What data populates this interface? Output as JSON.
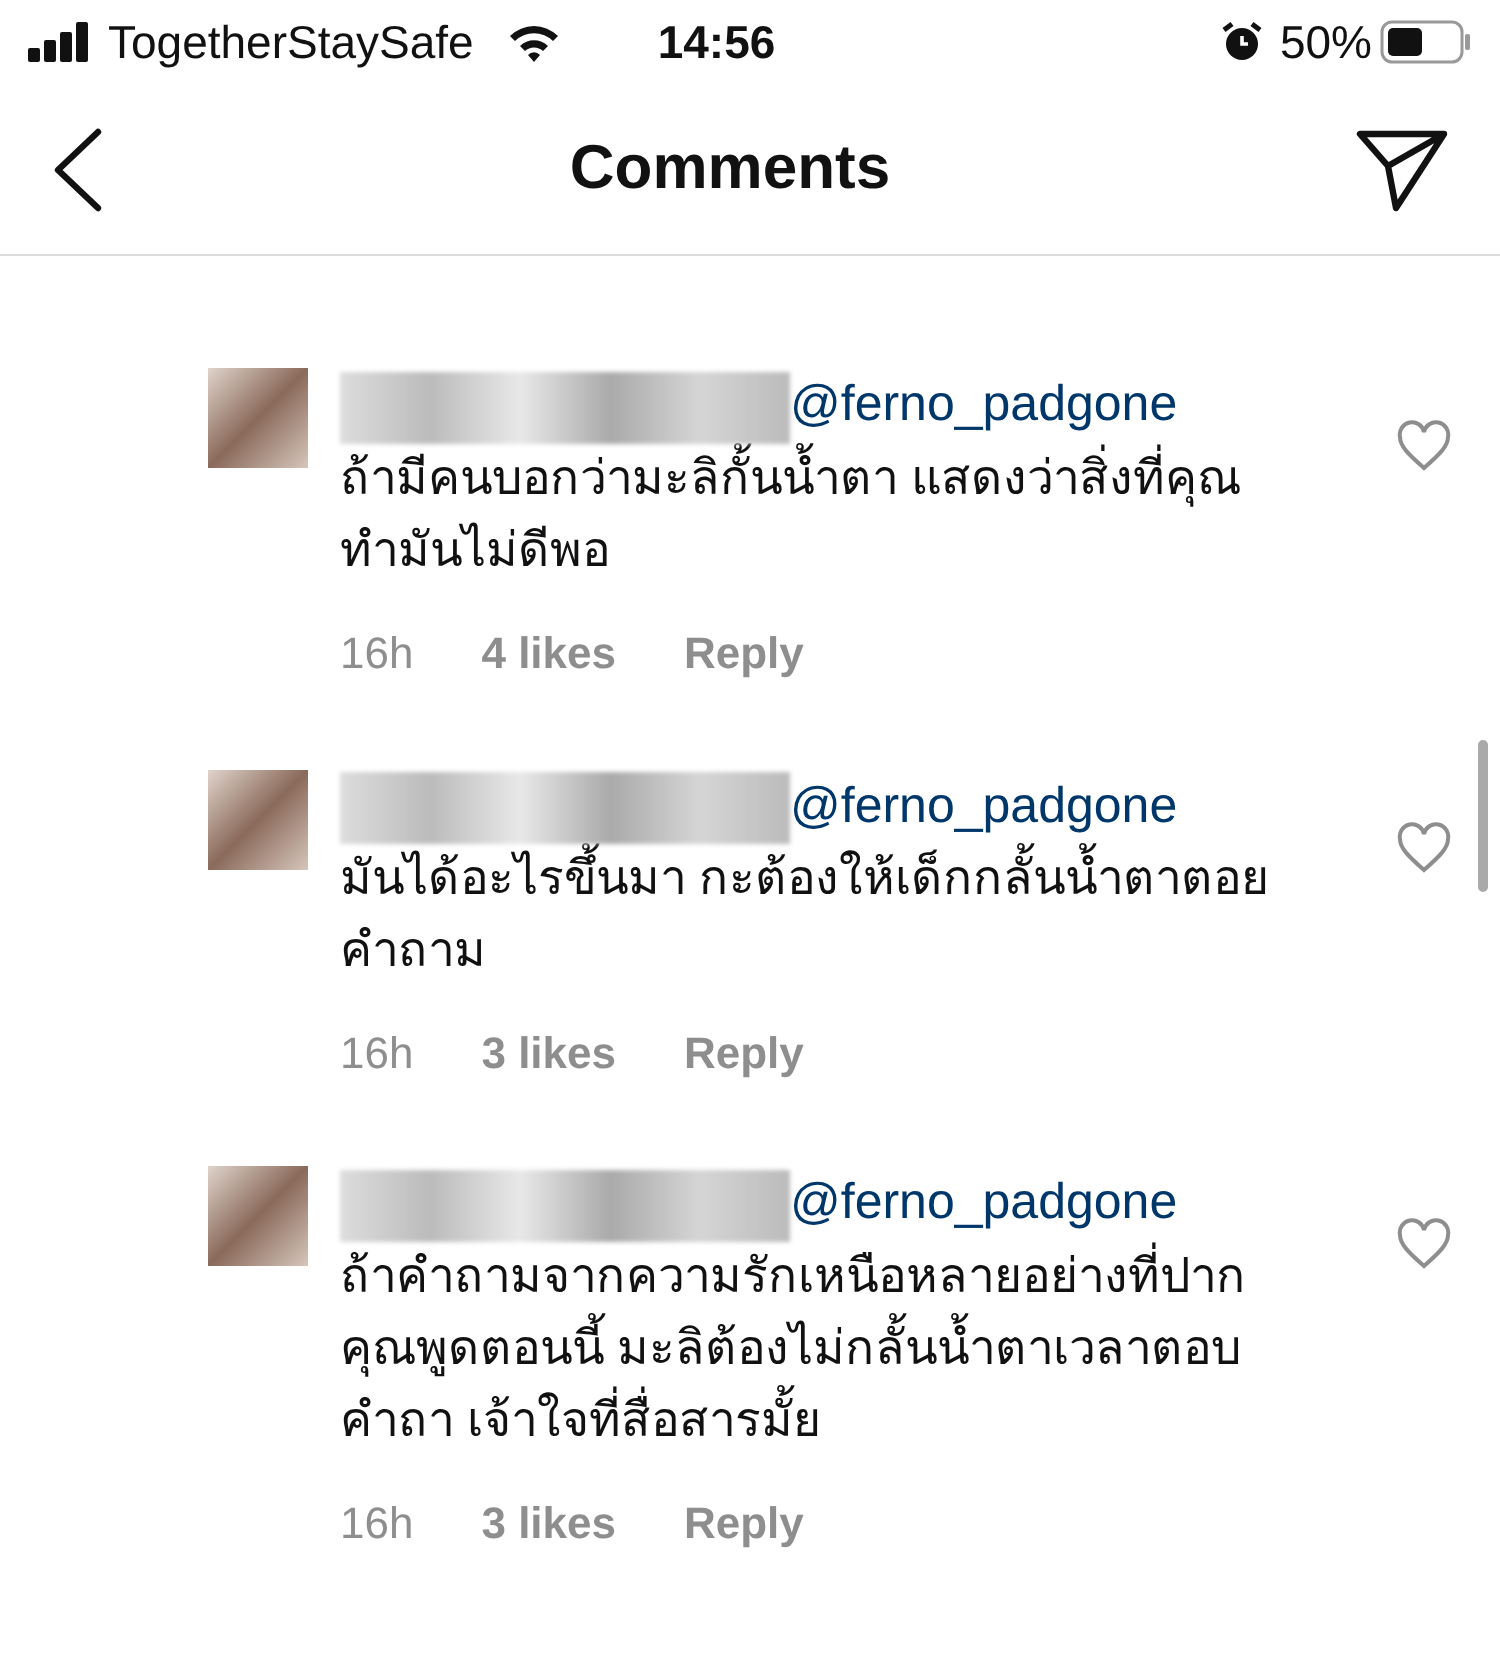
{
  "status_bar": {
    "carrier": "TogetherStaySafe",
    "time": "14:56",
    "battery": "50%"
  },
  "header": {
    "title": "Comments"
  },
  "comments": [
    {
      "mention": "@ferno_padgone",
      "text": "ถ้ามีคนบอกว่ามะลิกั้นน้ำตา แสดงว่าสิ่งที่คุณทำมันไม่ดีพอ",
      "time": "16h",
      "likes": "4 likes",
      "reply": "Reply",
      "liked": false
    },
    {
      "mention": "@ferno_padgone",
      "text": "มันได้อะไรขึ้นมา กะต้องให้เด็กกลั้นน้ำตาตอยคำถาม",
      "time": "16h",
      "likes": "3 likes",
      "reply": "Reply",
      "liked": false
    },
    {
      "mention": "@ferno_padgone",
      "text": "ถ้าคำถามจากความรักเหนือหลายอย่างที่ปากคุณพูดตอนนี้ มะลิต้องไม่กลั้นน้ำตาเวลาตอบคำถา  เจ้าใจที่สื่อสารมั้ย",
      "time": "16h",
      "likes": "3 likes",
      "reply": "Reply",
      "liked": false
    }
  ]
}
